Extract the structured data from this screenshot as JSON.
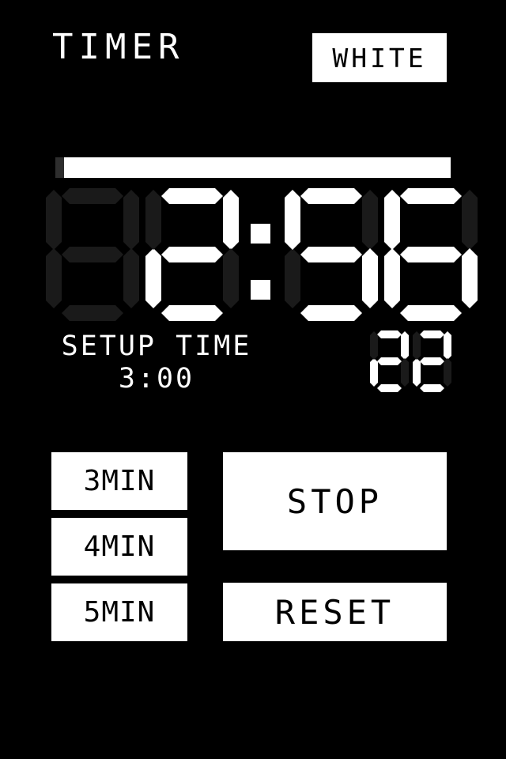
{
  "header": {
    "title": "TIMER",
    "mode_button_label": "WHITE"
  },
  "progress": {
    "percent_remaining": 97.8,
    "fill_color": "#ffffff",
    "track_color": "#2e2e2e"
  },
  "display": {
    "time_text": " 2:56",
    "digits": [
      {
        "char": " ",
        "segments": {
          "a": false,
          "b": false,
          "c": false,
          "d": false,
          "e": false,
          "f": false,
          "g": false
        }
      },
      {
        "char": "2",
        "segments": {
          "a": true,
          "b": true,
          "c": false,
          "d": true,
          "e": true,
          "f": false,
          "g": true
        }
      },
      {
        "char": "5",
        "segments": {
          "a": true,
          "b": false,
          "c": true,
          "d": true,
          "e": false,
          "f": true,
          "g": true
        }
      },
      {
        "char": "6",
        "segments": {
          "a": true,
          "b": false,
          "c": true,
          "d": true,
          "e": true,
          "f": true,
          "g": true
        }
      }
    ],
    "colon_visible": true,
    "segment_on_color": "#ffffff",
    "segment_off_color": "#1a1a1a"
  },
  "centiseconds": {
    "value_text": "22",
    "digits": [
      {
        "char": "2",
        "segments": {
          "a": true,
          "b": true,
          "c": false,
          "d": true,
          "e": true,
          "f": false,
          "g": true
        }
      },
      {
        "char": "2",
        "segments": {
          "a": true,
          "b": true,
          "c": false,
          "d": true,
          "e": true,
          "f": false,
          "g": true
        }
      }
    ]
  },
  "setup": {
    "label": "SETUP TIME",
    "value": "3:00"
  },
  "presets": [
    {
      "label": "3MIN"
    },
    {
      "label": "4MIN"
    },
    {
      "label": "5MIN"
    }
  ],
  "actions": {
    "stop_label": "STOP",
    "reset_label": "RESET"
  },
  "theme": {
    "background": "#000000",
    "foreground": "#ffffff"
  }
}
